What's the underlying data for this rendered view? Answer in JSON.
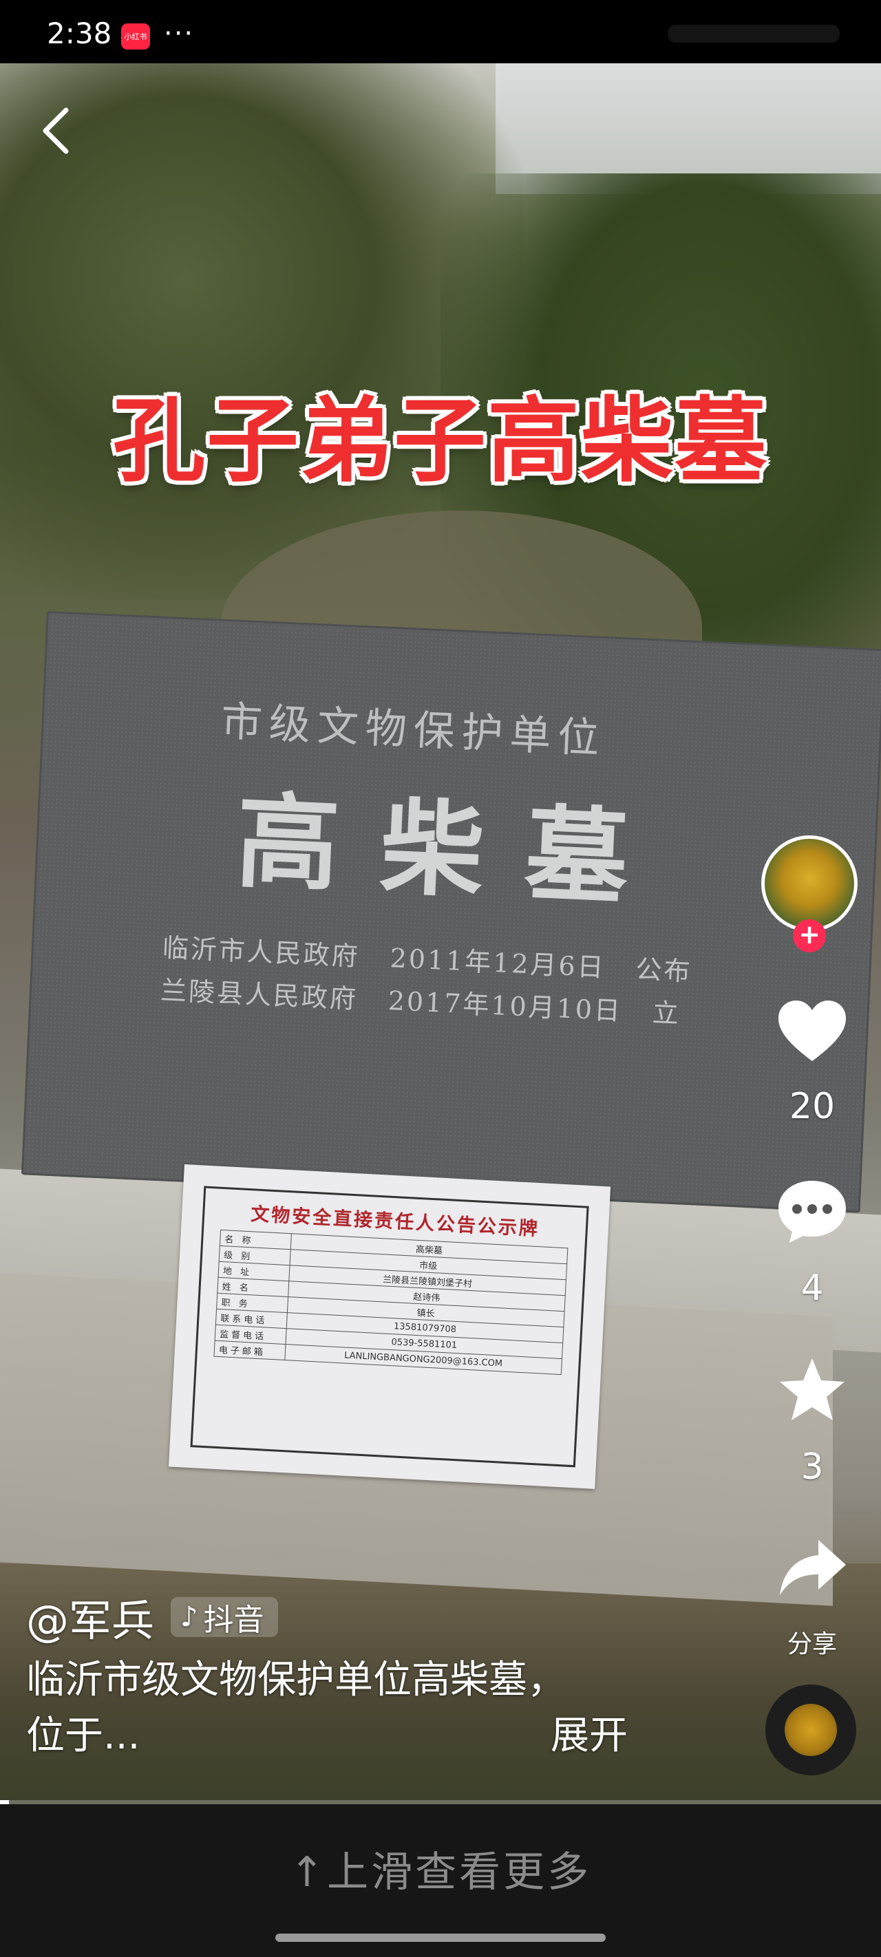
{
  "status_bar": {
    "time": "2:38",
    "app_badge": "小红书",
    "more": "···"
  },
  "video": {
    "overlay_title": "孔子弟子高柴墓",
    "stone": {
      "header": "市级文物保护单位",
      "name": "高柴墓",
      "lines": [
        {
          "issuer": "临沂市人民政府",
          "date": "2011年12月6日",
          "action": "公布"
        },
        {
          "issuer": "兰陵县人民政府",
          "date": "2017年10月10日",
          "action": "立"
        }
      ]
    },
    "notice": {
      "title": "文物安全直接责任人公告公示牌",
      "rows": [
        {
          "label": "名 称",
          "value": "高柴墓"
        },
        {
          "label": "级 别",
          "value": "市级"
        },
        {
          "label": "地 址",
          "value": "兰陵县兰陵镇刘堡子村"
        },
        {
          "label": "姓 名",
          "value": "赵诗伟"
        },
        {
          "label": "职 务",
          "value": "镇长"
        },
        {
          "label": "联系电话",
          "value": "13581079708"
        },
        {
          "label": "监督电话",
          "value": "0539-5581101"
        },
        {
          "label": "电子邮箱",
          "value": "LANLINGBANGONG2009@163.COM"
        }
      ]
    },
    "progress": 0.01
  },
  "right_rail": {
    "like_count": "20",
    "comment_count": "4",
    "favorite_count": "3",
    "share_label": "分享",
    "accent_color": "#fe2c55"
  },
  "caption": {
    "author": "@军兵",
    "tag": "抖音",
    "line1": "临沂市级文物保护单位高柴墓，",
    "line2": "位于...",
    "expand": "展开"
  },
  "bottom": {
    "swipe_hint": "↑上滑查看更多"
  }
}
